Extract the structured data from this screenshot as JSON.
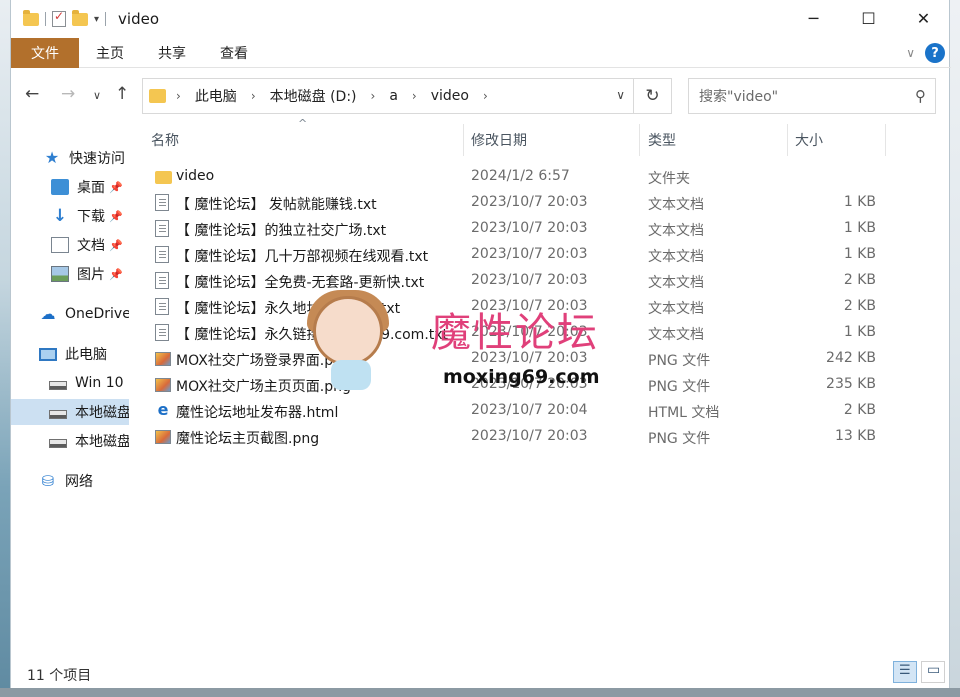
{
  "window": {
    "title": "video",
    "controls": {
      "minimize": "─",
      "maximize": "☐",
      "close": "✕"
    }
  },
  "ribbon": {
    "tabs": [
      "文件",
      "主页",
      "共享",
      "查看"
    ],
    "help": "?"
  },
  "address": {
    "crumbs": [
      "此电脑",
      "本地磁盘 (D:)",
      "a",
      "video"
    ],
    "search_placeholder": "搜索\"video\""
  },
  "sidebar": {
    "items": [
      {
        "label": "快速访问",
        "icon": "star-icon"
      },
      {
        "label": "桌面",
        "icon": "desktop-icon",
        "pinned": true
      },
      {
        "label": "下载",
        "icon": "download-icon",
        "pinned": true
      },
      {
        "label": "文档",
        "icon": "document-icon",
        "pinned": true
      },
      {
        "label": "图片",
        "icon": "pictures-icon",
        "pinned": true
      },
      {
        "label": "OneDrive",
        "icon": "cloud-icon"
      },
      {
        "label": "此电脑",
        "icon": "computer-icon"
      },
      {
        "label": "Win 10",
        "icon": "drive-icon"
      },
      {
        "label": "本地磁盘",
        "icon": "drive-icon",
        "selected": true
      },
      {
        "label": "本地磁盘",
        "icon": "drive-icon"
      },
      {
        "label": "网络",
        "icon": "network-icon"
      }
    ]
  },
  "columns": {
    "name": "名称",
    "date": "修改日期",
    "type": "类型",
    "size": "大小"
  },
  "files": [
    {
      "name": "video",
      "date": "2024/1/2 6:57",
      "type": "文件夹",
      "size": "",
      "icon": "folder-icon"
    },
    {
      "name": "【 魔性论坛】 发帖就能赚钱.txt",
      "date": "2023/10/7 20:03",
      "type": "文本文档",
      "size": "1 KB",
      "icon": "text-file-icon"
    },
    {
      "name": "【 魔性论坛】的独立社交广场.txt",
      "date": "2023/10/7 20:03",
      "type": "文本文档",
      "size": "1 KB",
      "icon": "text-file-icon"
    },
    {
      "name": "【 魔性论坛】几十万部视频在线观看.txt",
      "date": "2023/10/7 20:03",
      "type": "文本文档",
      "size": "1 KB",
      "icon": "text-file-icon"
    },
    {
      "name": "【 魔性论坛】全免费-无套路-更新快.txt",
      "date": "2023/10/7 20:03",
      "type": "文本文档",
      "size": "2 KB",
      "icon": "text-file-icon"
    },
    {
      "name": "【 魔性论坛】永久地址发布邮箱.txt",
      "date": "2023/10/7 20:03",
      "type": "文本文档",
      "size": "2 KB",
      "icon": "text-file-icon"
    },
    {
      "name": "【 魔性论坛】永久链接moxing69.com.txt",
      "date": "2023/10/7 20:03",
      "type": "文本文档",
      "size": "1 KB",
      "icon": "text-file-icon"
    },
    {
      "name": "MOX社交广场登录界面.png",
      "date": "2023/10/7 20:03",
      "type": "PNG 文件",
      "size": "242 KB",
      "icon": "image-file-icon"
    },
    {
      "name": "MOX社交广场主页页面.png",
      "date": "2023/10/7 20:03",
      "type": "PNG 文件",
      "size": "235 KB",
      "icon": "image-file-icon"
    },
    {
      "name": "魔性论坛地址发布器.html",
      "date": "2023/10/7 20:04",
      "type": "HTML 文档",
      "size": "2 KB",
      "icon": "html-file-icon"
    },
    {
      "name": "魔性论坛主页截图.png",
      "date": "2023/10/7 20:03",
      "type": "PNG 文件",
      "size": "13 KB",
      "icon": "image-file-icon"
    }
  ],
  "watermark": {
    "text": "魔性论坛",
    "url": "moxing69.com"
  },
  "status": {
    "item_count": "11 个项目"
  }
}
